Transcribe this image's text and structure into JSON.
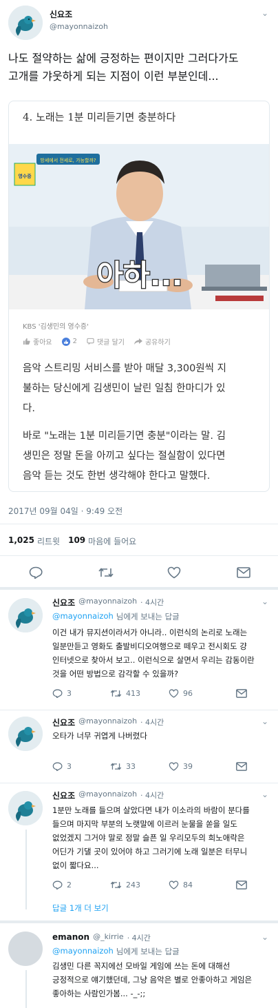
{
  "tweet": {
    "author": {
      "name": "신요조",
      "handle": "@mayonnaizoh"
    },
    "text_lines": [
      "나도 절약하는 삶에 긍정하는 편이지만 그러다가도",
      "고개를 갸웃하게 되는 지점이 이런 부분인데..."
    ],
    "card": {
      "title": "4. 노래는 1분 미리듣기면 충분하다",
      "image_overlay": "아하...",
      "image_badge": "방세에서 전세로, 가능할까?",
      "image_logo": "영수증",
      "source": "KBS '김생민의 영수증'",
      "like_label": "좋아요",
      "like_count": "2",
      "comment_label": "댓글 달기",
      "share_label": "공유하기",
      "para1": [
        "음악 스트리밍 서비스를 받아 매달 3,300원씩 지",
        "불하는 당신에게 김생민이 날린 일침 한마디가 있",
        "다."
      ],
      "para2": [
        "바로 \"노래는 1분 미리듣기면 충분\"이라는 말. 김",
        "생민은 정말 돈을 아끼고 싶다는 절실함이 있다면",
        "음악 듣는 것도 한번 생각해야 한다고 말했다."
      ]
    },
    "timestamp": "2017년 09월 04일 · 9:49 오전",
    "stats": {
      "retweets": "1,025",
      "retweets_label": "리트윗",
      "likes": "109",
      "likes_label": "마음에 들어요"
    }
  },
  "replies": [
    {
      "name": "신요조",
      "handle": "@mayonnaizoh",
      "time": "· 4시간",
      "reply_to_handle": "@mayonnaizoh",
      "reply_to_suffix": "님에게 보내는 답글",
      "lines": [
        "이건 내가 뮤지션이라서가 아니라.. 이런식의 논리로 노래는",
        "일분만듣고 영화도 출발비디오여행으로 떼우고 전시회도 걍",
        "인터넷으로 찾아서 보고.. 이런식으로 살면서 우리는 감동이란",
        "것을 어떤 방법으로 감각할 수 있을까?"
      ],
      "replies_count": "3",
      "retweets_count": "413",
      "likes_count": "96"
    },
    {
      "name": "신요조",
      "handle": "@mayonnaizoh",
      "time": "· 4시간",
      "lines": [
        "오타가 너무 귀엽게 나버렸다"
      ],
      "replies_count": "3",
      "retweets_count": "33",
      "likes_count": "39"
    },
    {
      "name": "신요조",
      "handle": "@mayonnaizoh",
      "time": "· 4시간",
      "lines": [
        "1분만 노래를 들으며 살았다면 내가 이소라의 바람이 분다를",
        "들으며 마지막 부분의 노랫말에 이르러 눈물을 쏟을 일도",
        "없었겠지 그거야 말로 정말 슬픈 일 우리모두의 희노애락은",
        "어딘가 기댈 곳이 있어야 하고 그러기에 노래 일분은 터무니",
        "없이 짧다요..."
      ],
      "replies_count": "2",
      "retweets_count": "243",
      "likes_count": "84",
      "more_replies": "답글 1개 더 보기"
    },
    {
      "name": "emanon",
      "handle": "@_kirrie",
      "time": "· 4시간",
      "reply_to_handle": "@mayonnaizoh",
      "reply_to_suffix": "님에게 보내는 답글",
      "lines": [
        "김생민 다른 꼭지에선 모바일 게임에 쓰는 돈에 대해선",
        "긍정적으로 얘기했던데, 그냥 음악은 별로 안좋아하고 게임은",
        "좋아하는 사람인가봄... -_-;;"
      ]
    }
  ],
  "icons": {
    "avatar_bird": "bird-illustration",
    "chevron": "chevron-down-icon"
  },
  "colors": {
    "accent": "#1da1f2",
    "muted": "#657786",
    "border": "#e6ecf0"
  }
}
